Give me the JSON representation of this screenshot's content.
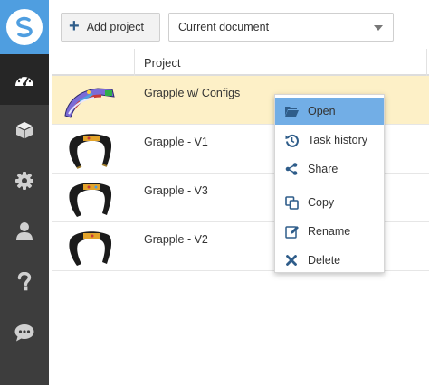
{
  "sidebar": {
    "items": [
      {
        "name": "dashboard",
        "icon": "dashboard-icon",
        "active": true
      },
      {
        "name": "parts",
        "icon": "cube-icon",
        "active": false
      },
      {
        "name": "settings",
        "icon": "gear-icon",
        "active": false
      },
      {
        "name": "account",
        "icon": "user-icon",
        "active": false
      },
      {
        "name": "help",
        "icon": "question-icon",
        "active": false
      },
      {
        "name": "feedback",
        "icon": "chat-icon",
        "active": false
      }
    ],
    "colors": {
      "background": "#3d3d3d",
      "active": "#262626",
      "logo": "#4f9ee0",
      "icon": "#d0d0d0"
    }
  },
  "toolbar": {
    "add_project_label": "Add project",
    "filter_selected": "Current document"
  },
  "table": {
    "header": "Project",
    "rows": [
      {
        "name": "Grapple w/ Configs",
        "selected": true
      },
      {
        "name": "Grapple - V1",
        "selected": false
      },
      {
        "name": "Grapple - V3",
        "selected": false
      },
      {
        "name": "Grapple - V2",
        "selected": false
      }
    ],
    "colors": {
      "selected": "#fdf0c7"
    }
  },
  "context_menu": {
    "items": [
      {
        "label": "Open",
        "icon": "folder-open-icon",
        "active": true
      },
      {
        "label": "Task history",
        "icon": "history-icon",
        "active": false
      },
      {
        "label": "Share",
        "icon": "share-icon",
        "active": false
      },
      {
        "label": "Copy",
        "icon": "copy-icon",
        "active": false
      },
      {
        "label": "Rename",
        "icon": "edit-icon",
        "active": false
      },
      {
        "label": "Delete",
        "icon": "close-icon",
        "active": false
      }
    ],
    "colors": {
      "active": "#72aee6",
      "icon": "#2f5d8a"
    }
  }
}
